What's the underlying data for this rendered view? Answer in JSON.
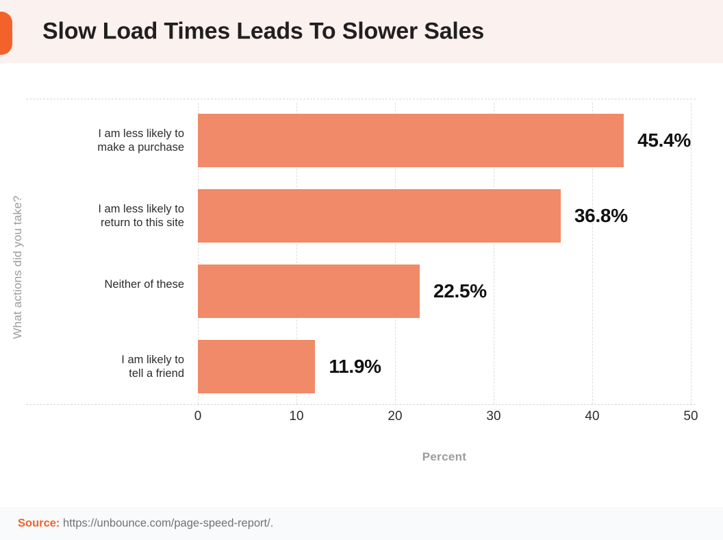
{
  "header": {
    "title": "Slow Load Times Leads To Slower Sales",
    "accent_color": "#f2622a",
    "background": "#fbf2f0"
  },
  "footer": {
    "source_label": "Source:",
    "source_url": "https://unbounce.com/page-speed-report/.",
    "background": "#f8fafb"
  },
  "chart_data": {
    "type": "bar",
    "orientation": "horizontal",
    "title": "Slow Load Times Leads To Slower Sales",
    "categories": [
      "I am less likely to\nmake a purchase",
      "I am less likely to\nreturn to this site",
      "Neither of these",
      "I am likely to\ntell a friend"
    ],
    "values": [
      45.4,
      36.8,
      22.5,
      11.9
    ],
    "data_labels": [
      "45.4%",
      "36.8%",
      "22.5%",
      "11.9%"
    ],
    "xlabel": "Percent",
    "ylabel": "What actions did you take?",
    "xlim": [
      0,
      50
    ],
    "xticks": [
      0,
      10,
      20,
      30,
      40,
      50
    ],
    "xtick_labels": [
      "0",
      "10",
      "20",
      "30",
      "40",
      "50"
    ],
    "grid": "vertical-dashed",
    "legend": "none",
    "bar_color": "#f18a68",
    "label_color": "#111111",
    "axis_title_color": "#9b9b9b"
  }
}
